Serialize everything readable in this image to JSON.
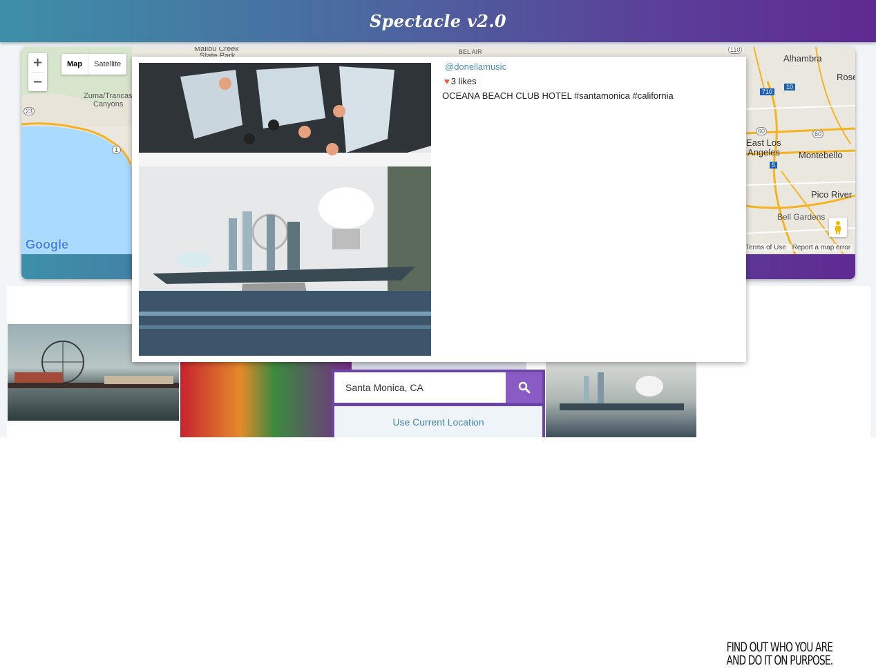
{
  "header": {
    "title": "Spectacle v2.0"
  },
  "map": {
    "zoom_in": "+",
    "zoom_out": "−",
    "type_map": "Map",
    "type_satellite": "Satellite",
    "labels": {
      "malibu_creek": "Malibu Creek",
      "state_park": "State Park",
      "zuma": "Zuma/Trancas",
      "canyons": "Canyons",
      "bel_air": "BEL AIR",
      "alhambra": "Alhambra",
      "rose": "Rose",
      "east_los": "East Los",
      "angeles": "Angeles",
      "montebello": "Montebello",
      "pico_river": "Pico River",
      "bell_gardens": "Bell Gardens"
    },
    "shields": {
      "r23": "23",
      "r1": "1",
      "r710": "710",
      "r10": "10",
      "r60a": "60",
      "r60b": "60",
      "r5": "5",
      "r110": "110"
    },
    "google_logo": "Google",
    "terms": "Terms of Use",
    "report": "Report a map error"
  },
  "popup": {
    "username": "@donellamusic",
    "likes": "3 likes",
    "caption": "OCEANA BEACH CLUB HOTEL #santamonica #california"
  },
  "search": {
    "value": "Santa Monica, CA",
    "location_button": "Use Current Location"
  },
  "gallery": {
    "quote_line1": "FIND OUT WHO YOU ARE",
    "quote_line2": "AND DO IT ON PURPOSE."
  }
}
